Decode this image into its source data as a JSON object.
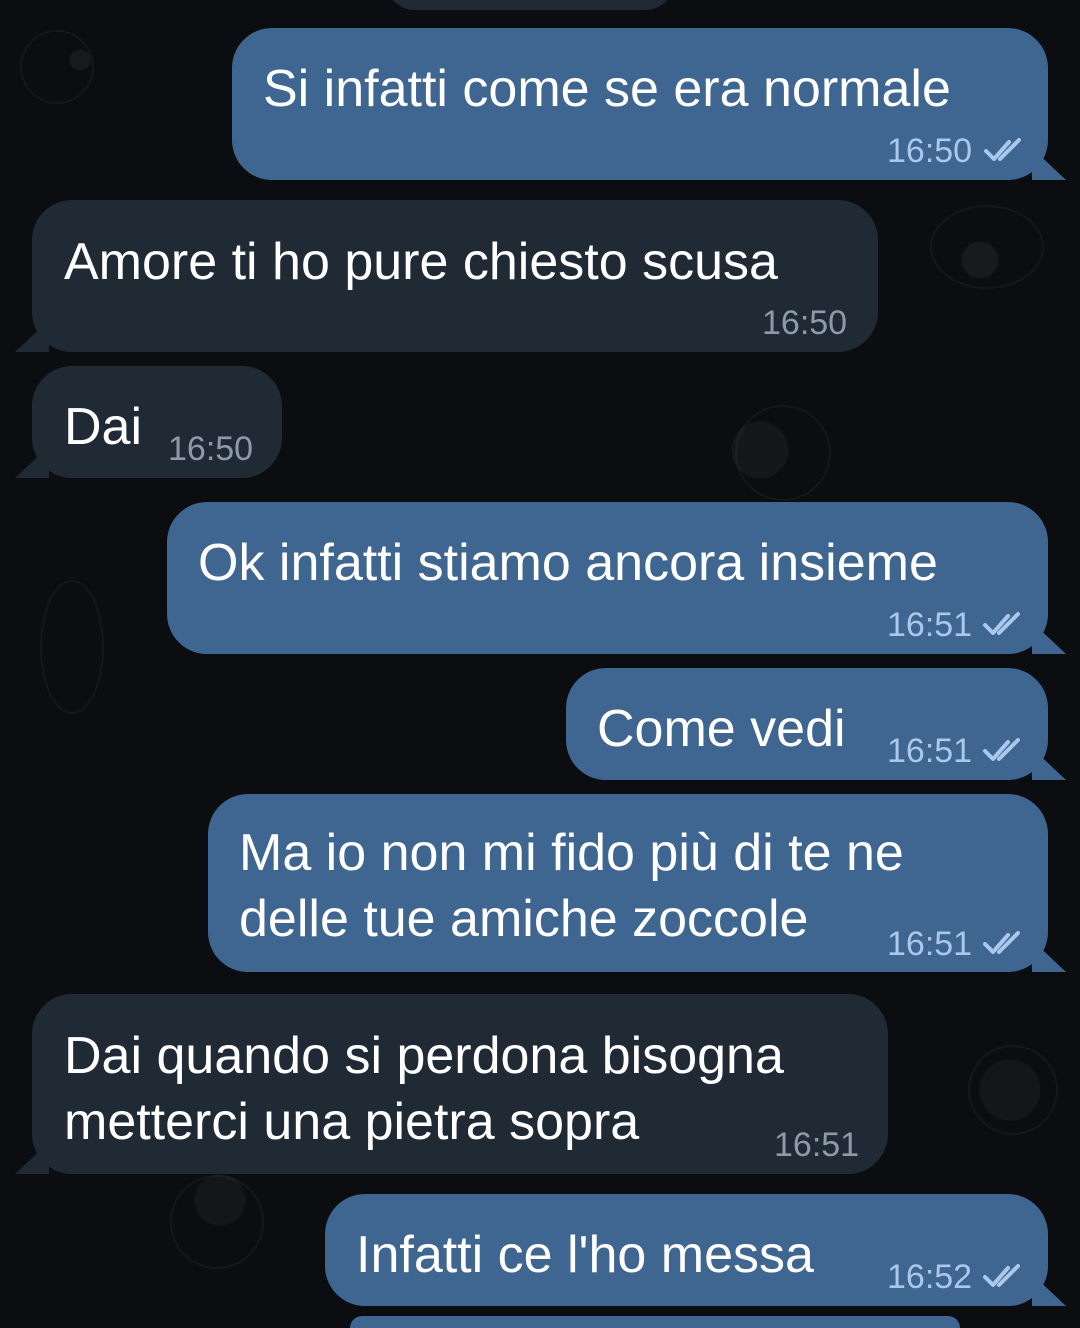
{
  "messages": [
    {
      "side": "out",
      "text": "Si infatti come se era normale",
      "time": "16:50",
      "status": "read"
    },
    {
      "side": "in",
      "text": "Amore ti ho pure chiesto scusa",
      "time": "16:50"
    },
    {
      "side": "in",
      "text": "Dai",
      "time": "16:50"
    },
    {
      "side": "out",
      "text": "Ok infatti stiamo ancora insieme",
      "time": "16:51",
      "status": "read"
    },
    {
      "side": "out",
      "text": "Come vedi",
      "time": "16:51",
      "status": "read"
    },
    {
      "side": "out",
      "text": "Ma io non mi fido più di te ne\ndelle tue amiche zoccole",
      "time": "16:51",
      "status": "read"
    },
    {
      "side": "in",
      "text": "Dai quando si perdona bisogna\nmetterci una pietra sopra",
      "time": "16:51"
    },
    {
      "side": "out",
      "text": "Infatti ce l'ho messa",
      "time": "16:52",
      "status": "read"
    }
  ],
  "icons": {
    "read_receipt": "double-check-icon"
  },
  "colors": {
    "background": "#0b0d10",
    "outgoing_bubble": "#3f6591",
    "incoming_bubble": "#1f2a34",
    "outgoing_meta": "#a9c8ec",
    "incoming_meta": "#8e9aa6"
  }
}
